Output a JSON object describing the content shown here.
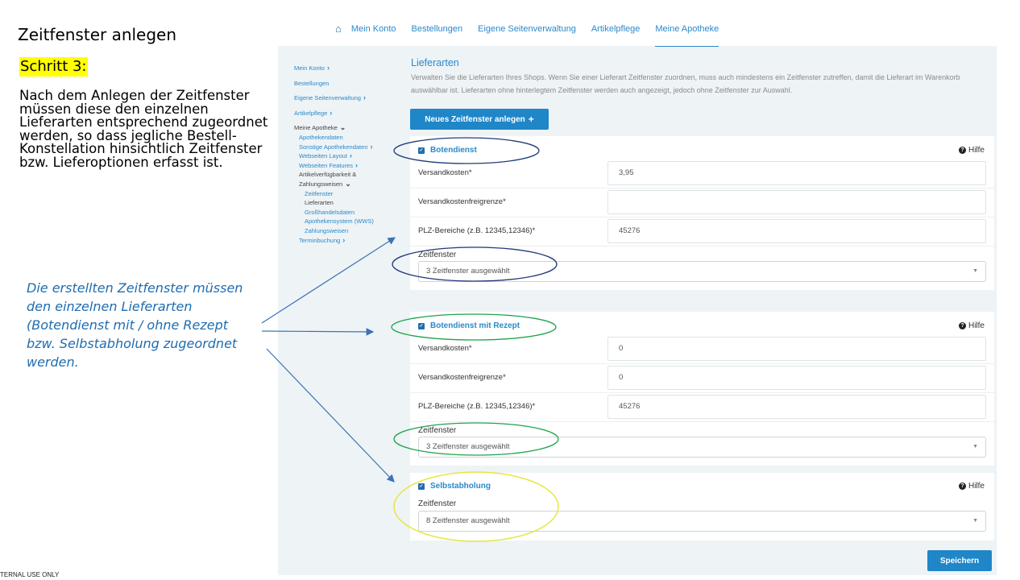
{
  "slide": {
    "title": "Zeitfenster anlegen",
    "step": "Schritt 3:",
    "body": "Nach dem Anlegen der Zeitfenster müssen diese den einzelnen Lieferarten entsprechend zugeordnet werden, so dass jegliche Bestell-Konstellation hinsichtlich Zeitfenster bzw. Lieferoptionen erfasst ist.",
    "callout": "Die erstellten Zeitfenster müssen den einzelnen Lieferarten (Botendienst mit / ohne Rezept bzw. Selbstabholung zugeordnet werden.",
    "footer": "TERNAL USE ONLY"
  },
  "nav": {
    "home_icon": "home-icon",
    "items": [
      "Mein Konto",
      "Bestellungen",
      "Eigene Seitenverwaltung",
      "Artikelpflege",
      "Meine Apotheke"
    ]
  },
  "sidebar": {
    "mein_konto": "Mein Konto",
    "bestellungen": "Bestellungen",
    "seitenverwaltung": "Eigene Seitenverwaltung",
    "artikelpflege": "Artikelpflege",
    "meine_apotheke": "Meine Apotheke",
    "apothekendaten": "Apothekendaten",
    "sonstige": "Sonstige Apothekendaten",
    "layout": "Webseiten Layout",
    "features": "Webseiten Features",
    "verfuegbarkeit_1": "Artikelverfügbarkeit &",
    "verfuegbarkeit_2": "Zahlungsweisen",
    "zeitfenster": "Zeitfenster",
    "lieferarten": "Lieferarten",
    "grosshandel": "Großhandelsdaten",
    "wws": "Apothekensystem (WWS)",
    "zahlungsweisen": "Zahlungsweisen",
    "terminbuchung": "Terminbuchung"
  },
  "main": {
    "title": "Lieferarten",
    "description": "Verwalten Sie die Lieferarten Ihres Shops. Wenn Sie einer Lieferart Zeitfenster zuordnen, muss auch mindestens ein Zeitfenster zutreffen, damit die Lieferart im Warenkorb auswählbar ist. Lieferarten ohne hinterlegtem Zeitfenster werden auch angezeigt, jedoch ohne Zeitfenster zur Auswahl.",
    "new_button": "Neues Zeitfenster anlegen",
    "help_label": "Hilfe",
    "save_button": "Speichern"
  },
  "cards": [
    {
      "name": "Botendienst",
      "versandkosten_label": "Versandkosten*",
      "versandkosten": "3,95",
      "freigrenze_label": "Versandkostenfreigrenze*",
      "freigrenze": "",
      "plz_label": "PLZ-Bereiche (z.B. 12345,12346)*",
      "plz": "45276",
      "zeitfenster_label": "Zeitfenster",
      "zeitfenster": "3 Zeitfenster ausgewählt"
    },
    {
      "name": "Botendienst mit Rezept",
      "versandkosten_label": "Versandkosten*",
      "versandkosten": "0",
      "freigrenze_label": "Versandkostenfreigrenze*",
      "freigrenze": "0",
      "plz_label": "PLZ-Bereiche (z.B. 12345,12346)*",
      "plz": "45276",
      "zeitfenster_label": "Zeitfenster",
      "zeitfenster": "3 Zeitfenster ausgewählt"
    },
    {
      "name": "Selbstabholung",
      "zeitfenster_label": "Zeitfenster",
      "zeitfenster": "8 Zeitfenster ausgewählt"
    }
  ],
  "colors": {
    "accent": "#2b89c9",
    "button": "#1f86c8",
    "highlight_navy": "#1f3a7a",
    "highlight_green": "#1fa34a",
    "highlight_yellow": "#e6e640"
  }
}
